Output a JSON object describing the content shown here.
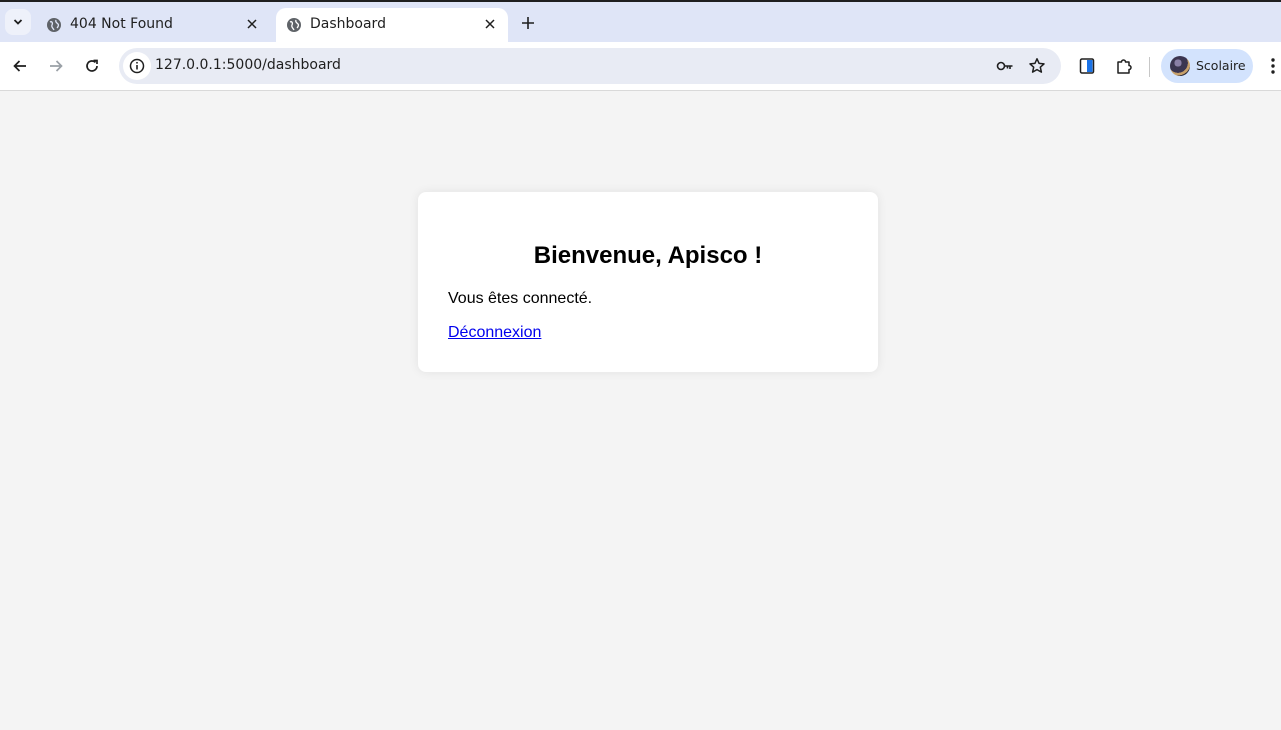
{
  "browser": {
    "tabs": [
      {
        "title": "404 Not Found",
        "active": false,
        "favicon": "globe-icon"
      },
      {
        "title": "Dashboard",
        "active": true,
        "favicon": "globe-icon"
      }
    ],
    "address_bar": {
      "url": "127.0.0.1:5000/dashboard"
    },
    "profile": {
      "name": "Scolaire"
    },
    "colors": {
      "tabstrip": "#dfe5f7",
      "omnibox": "#e8ebf4",
      "profile_chip": "#d3e3fd"
    }
  },
  "page": {
    "background": "#f4f4f4",
    "card": {
      "heading": "Bienvenue, Apisco !",
      "status_text": "Vous êtes connecté.",
      "logout_link": "Déconnexion"
    },
    "link_color": "#0000ee"
  }
}
